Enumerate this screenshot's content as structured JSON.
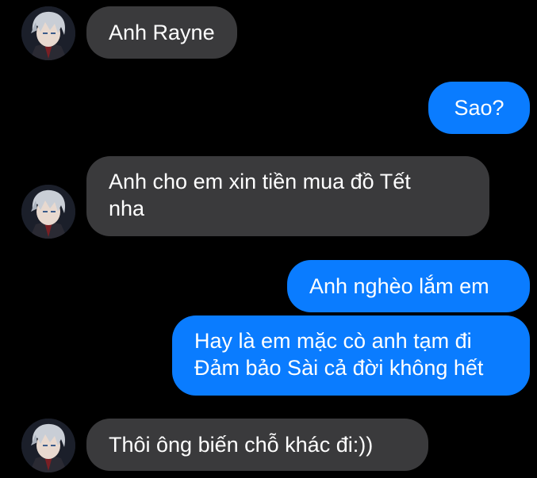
{
  "colors": {
    "background": "#000000",
    "incoming_bubble": "#3a3a3c",
    "outgoing_bubble": "#0a7cff",
    "text": "#ffffff"
  },
  "contact": {
    "avatar_icon": "anime-boy-avatar"
  },
  "messages": [
    {
      "direction": "incoming",
      "lines": [
        "Anh Rayne"
      ]
    },
    {
      "direction": "outgoing",
      "lines": [
        "Sao?"
      ]
    },
    {
      "direction": "incoming",
      "lines": [
        "Anh cho em xin tiền mua đồ Tết",
        "nha"
      ]
    },
    {
      "direction": "outgoing",
      "lines": [
        "Anh nghèo lắm em"
      ]
    },
    {
      "direction": "outgoing",
      "lines": [
        "Hay là em mặc cò anh tạm đi",
        "Đảm bảo Sài cả đời không hết"
      ]
    },
    {
      "direction": "incoming",
      "lines": [
        "Thôi ông biến chỗ khác đi:))"
      ]
    }
  ]
}
